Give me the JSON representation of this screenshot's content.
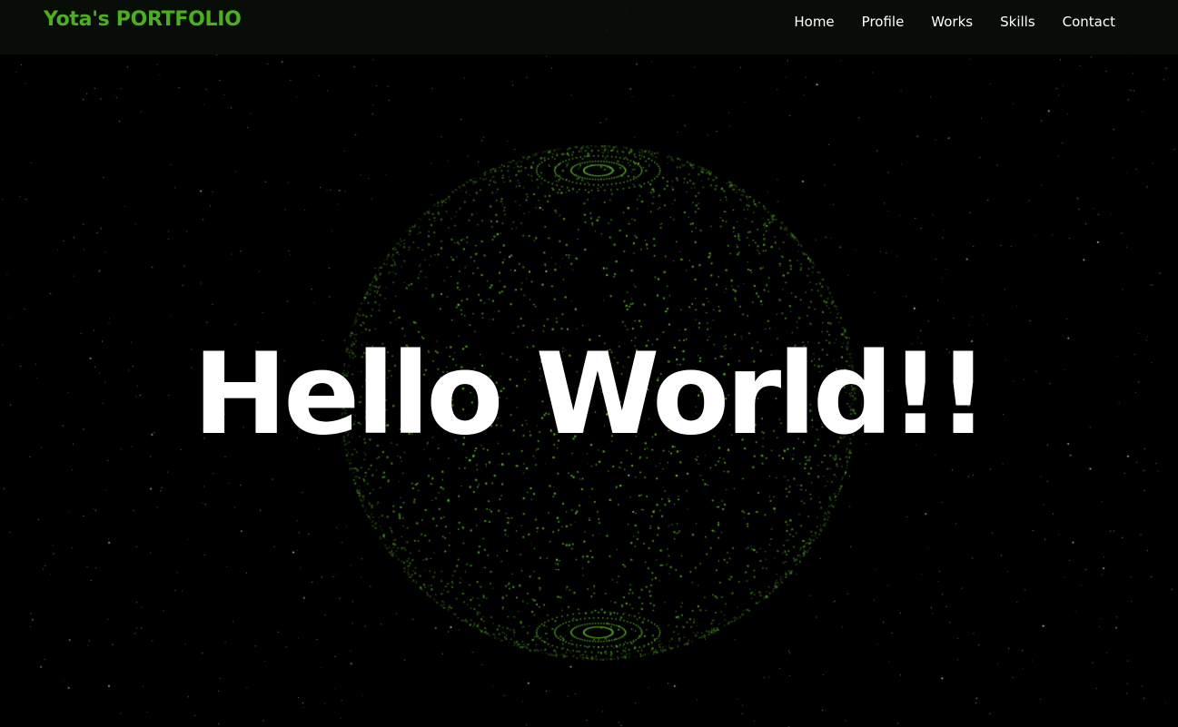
{
  "header": {
    "brand": "Yota's PORTFOLIO",
    "nav": [
      {
        "label": "Home"
      },
      {
        "label": "Profile"
      },
      {
        "label": "Works"
      },
      {
        "label": "Skills"
      },
      {
        "label": "Contact"
      }
    ]
  },
  "hero": {
    "title": "Hello World!!"
  },
  "colors": {
    "background": "#000000",
    "header_bg": "#0a0e08",
    "brand": "#4caf1f",
    "nav_text": "#ffffff",
    "hero_text": "#ffffff",
    "globe_dots": "#5fbf2a",
    "stars": "#ffffff"
  }
}
